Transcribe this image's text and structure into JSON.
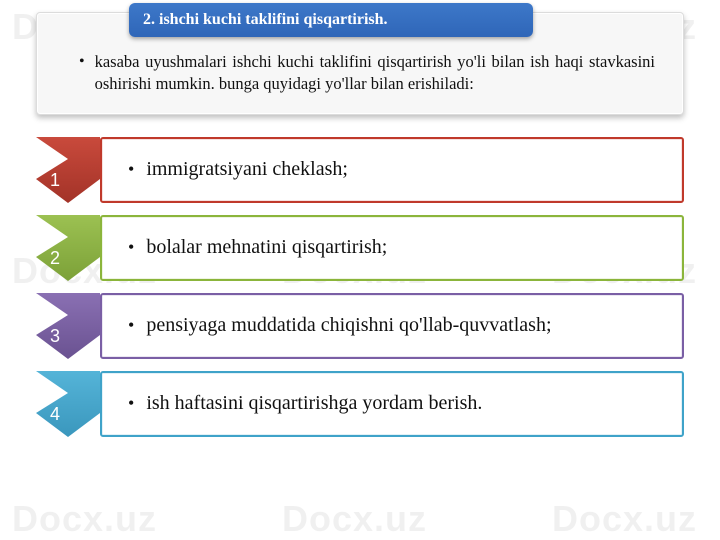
{
  "watermark": "Docx.uz",
  "header": {
    "tab": "2. ishchi kuchi taklifini qisqartirish.",
    "body": "kasaba uyushmalari ishchi kuchi taklifini qisqartirish yo'li bilan ish haqi stavkasini oshirishi mumkin. bunga quyidagi yo'llar bilan erishiladi:"
  },
  "rows": [
    {
      "num": "1",
      "text": "immigratsiyani cheklash;",
      "fill1": "#c94a3c",
      "fill2": "#a33328"
    },
    {
      "num": "2",
      "text": "bolalar mehnatini qisqartirish;",
      "fill1": "#9cc152",
      "fill2": "#7ca138"
    },
    {
      "num": "3",
      "text": "pensiyaga muddatida chiqishni qo'llab-quvvatlash;",
      "fill1": "#8a70b3",
      "fill2": "#6a5291"
    },
    {
      "num": "4",
      "text": "ish haftasini qisqartirishga yordam berish.",
      "fill1": "#55b4d8",
      "fill2": "#3a97bd"
    }
  ]
}
